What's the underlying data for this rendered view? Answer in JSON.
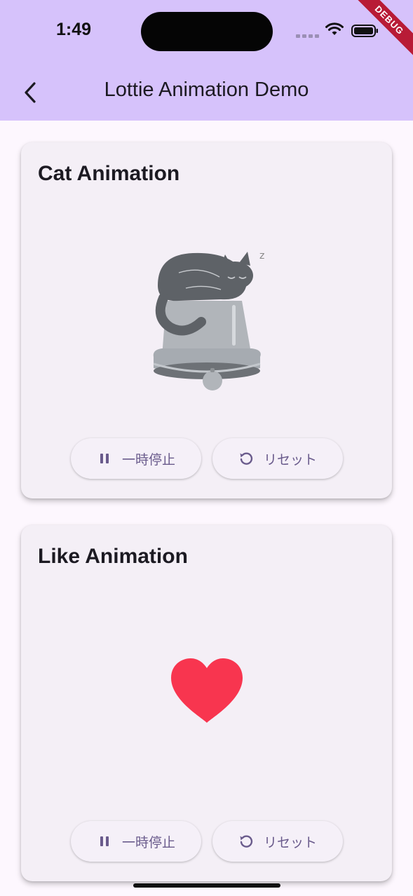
{
  "status_bar": {
    "time": "1:49",
    "debug_label": "DEBUG"
  },
  "app_bar": {
    "title": "Lottie Animation Demo"
  },
  "cards": [
    {
      "title": "Cat Animation",
      "pause_label": "一時停止",
      "reset_label": "リセット"
    },
    {
      "title": "Like Animation",
      "pause_label": "一時停止",
      "reset_label": "リセット"
    }
  ],
  "colors": {
    "app_bar": "#d6c2fb",
    "background": "#fdf7fe",
    "card": "#f4eff6",
    "button_text": "#6a5b8c",
    "heart": "#f8354f",
    "debug_banner": "#b81b36"
  },
  "icons": [
    "back-arrow-icon",
    "pause-icon",
    "reset-icon",
    "wifi-icon",
    "battery-icon"
  ]
}
